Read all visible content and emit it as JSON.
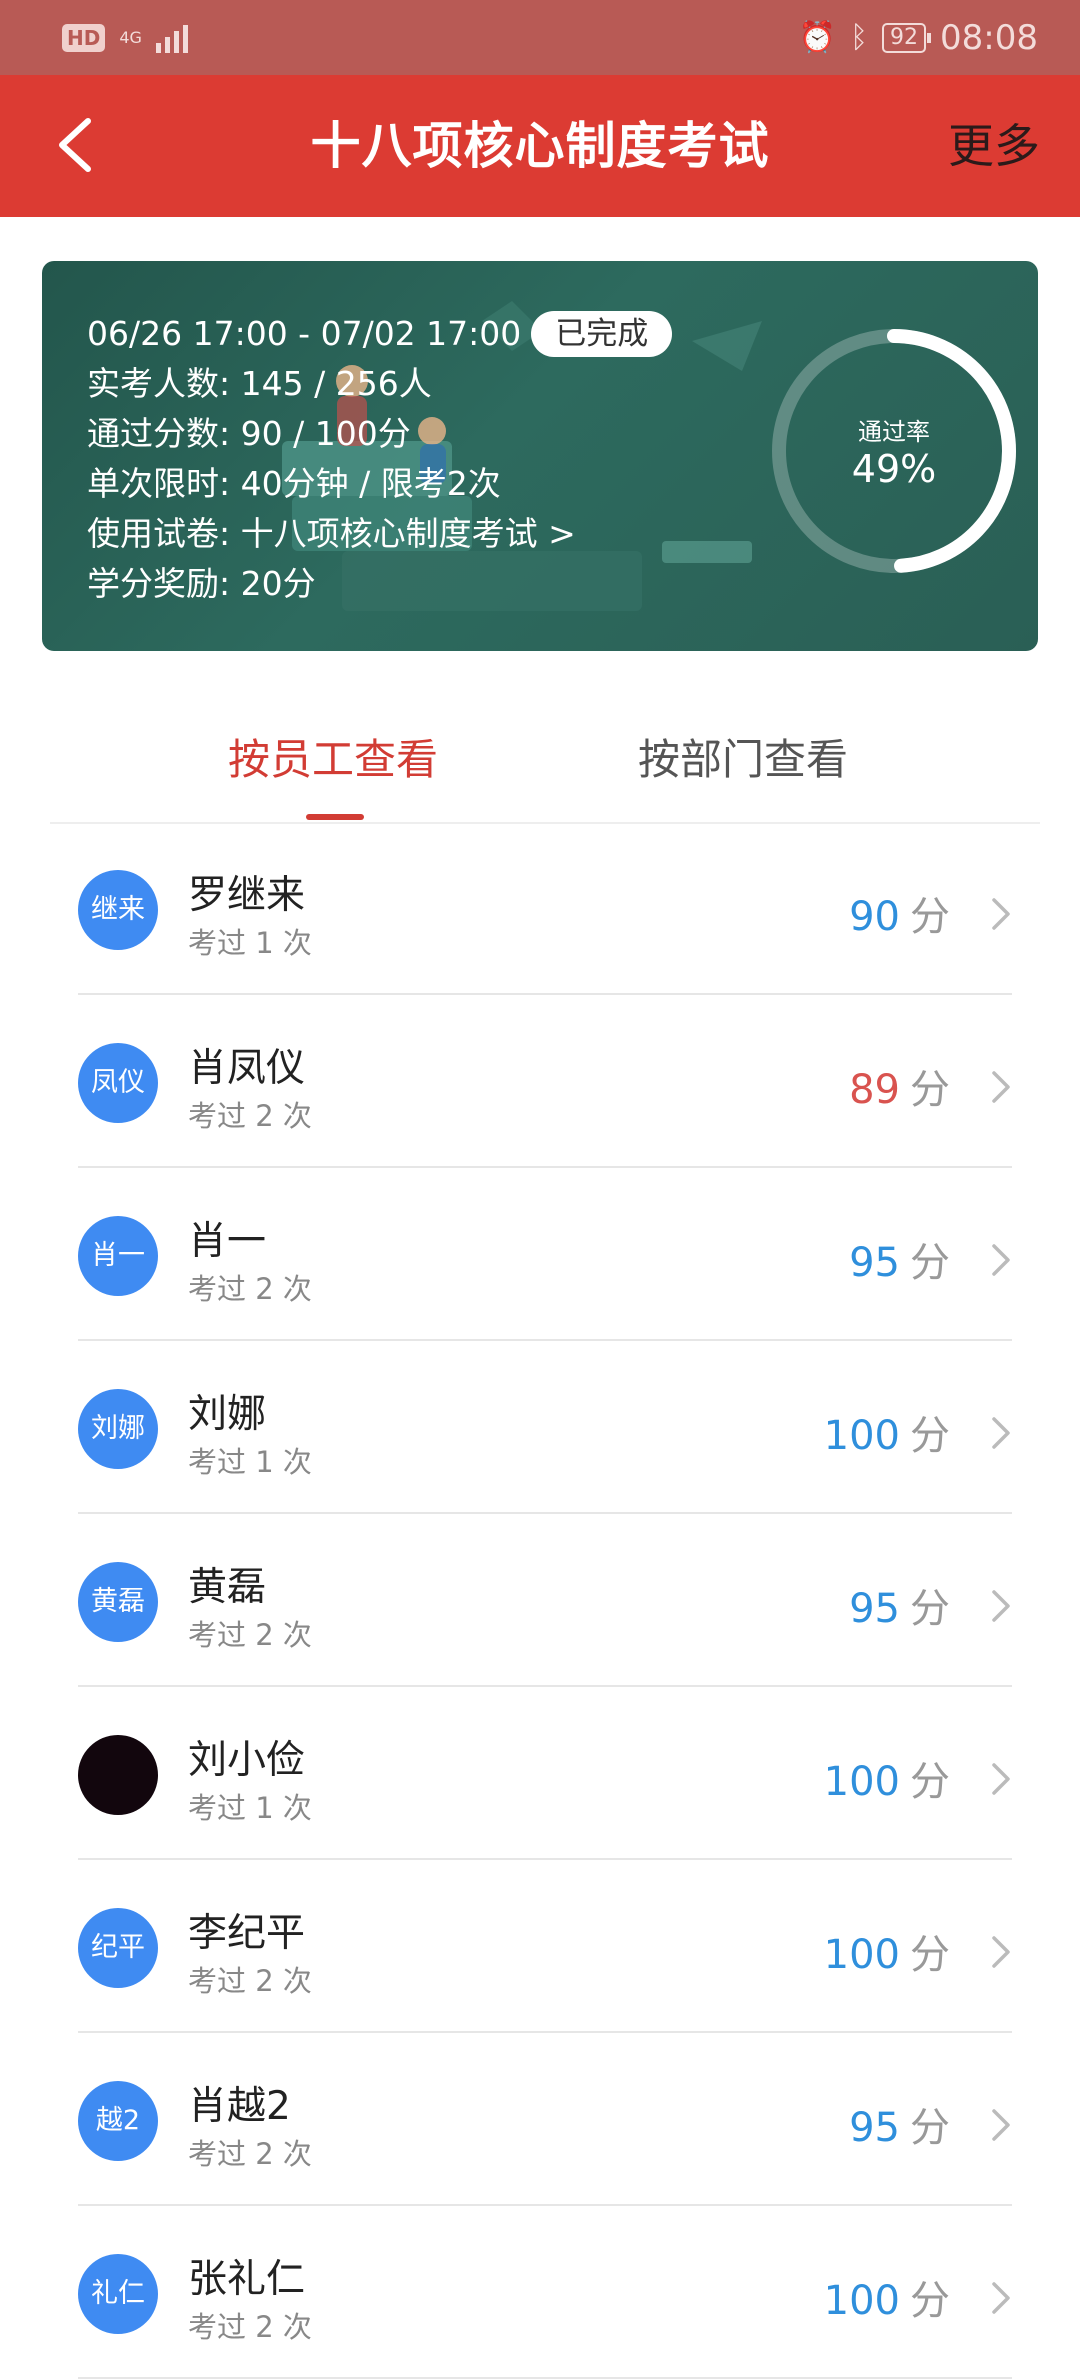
{
  "status_bar": {
    "hd": "HD",
    "network": "4G",
    "battery": "92",
    "time": "08:08"
  },
  "header": {
    "title": "十八项核心制度考试",
    "more_label": "更多"
  },
  "exam": {
    "date_range": "06/26 17:00 - 07/02 17:00",
    "status_badge": "已完成",
    "attendance_label": "实考人数:",
    "attendance_value": "145 / 256人",
    "pass_score_label": "通过分数:",
    "pass_score_value": "90 / 100分",
    "time_limit_label": "单次限时:",
    "time_limit_value": "40分钟 / 限考2次",
    "paper_label": "使用试卷:",
    "paper_value": "十八项核心制度考试 >",
    "credit_label": "学分奖励:",
    "credit_value": "20分",
    "pass_rate_label": "通过率",
    "pass_rate_value": "49%",
    "pass_rate_fraction": 0.49
  },
  "tabs": [
    {
      "label": "按员工查看",
      "active": true
    },
    {
      "label": "按部门查看",
      "active": false
    }
  ],
  "employees": [
    {
      "avatar_text": "继来",
      "name": "罗继来",
      "attempts": "考过 1 次",
      "score": "90",
      "unit": "分",
      "low": false
    },
    {
      "avatar_text": "凤仪",
      "name": "肖凤仪",
      "attempts": "考过 2 次",
      "score": "89",
      "unit": "分",
      "low": true
    },
    {
      "avatar_text": "肖一",
      "name": "肖一",
      "attempts": "考过 2 次",
      "score": "95",
      "unit": "分",
      "low": false
    },
    {
      "avatar_text": "刘娜",
      "name": "刘娜",
      "attempts": "考过 1 次",
      "score": "100",
      "unit": "分",
      "low": false
    },
    {
      "avatar_text": "黄磊",
      "name": "黄磊",
      "attempts": "考过 2 次",
      "score": "95",
      "unit": "分",
      "low": false
    },
    {
      "avatar_text": "",
      "name": "刘小俭",
      "attempts": "考过 1 次",
      "score": "100",
      "unit": "分",
      "low": false,
      "photo": true
    },
    {
      "avatar_text": "纪平",
      "name": "李纪平",
      "attempts": "考过 2 次",
      "score": "100",
      "unit": "分",
      "low": false
    },
    {
      "avatar_text": "越2",
      "name": "肖越2",
      "attempts": "考过 2 次",
      "score": "95",
      "unit": "分",
      "low": false
    },
    {
      "avatar_text": "礼仁",
      "name": "张礼仁",
      "attempts": "考过 2 次",
      "score": "100",
      "unit": "分",
      "low": false
    }
  ]
}
